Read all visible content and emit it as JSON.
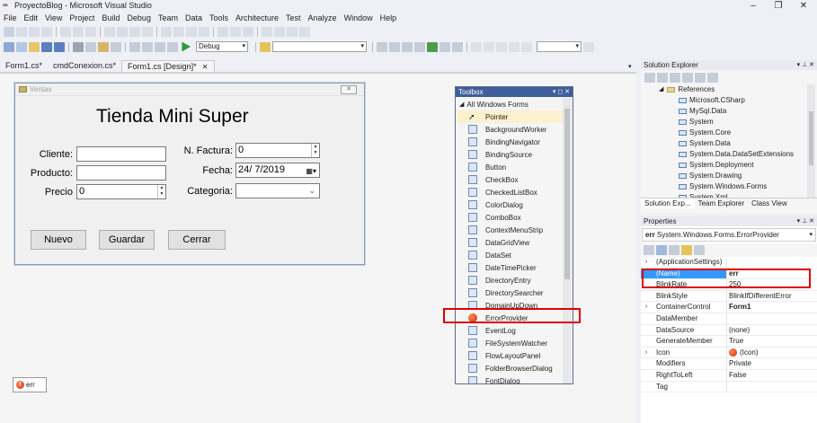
{
  "window": {
    "title": "ProyectoBlog - Microsoft Visual Studio",
    "min": "–",
    "restore": "❐",
    "close": "✕"
  },
  "menu": [
    "File",
    "Edit",
    "View",
    "Project",
    "Build",
    "Debug",
    "Team",
    "Data",
    "Tools",
    "Architecture",
    "Test",
    "Analyze",
    "Window",
    "Help"
  ],
  "toolbar": {
    "config": "Debug"
  },
  "tabs": [
    {
      "label": "Form1.cs*"
    },
    {
      "label": "cmdConexion.cs*"
    },
    {
      "label": "Form1.cs [Design]*",
      "active": true
    }
  ],
  "form": {
    "title": "Ventas",
    "heading": "Tienda Mini Super",
    "cliente_label": "Cliente:",
    "producto_label": "Producto:",
    "precio_label": "Precio",
    "precio_value": "0",
    "factura_label": "N. Factura:",
    "factura_value": "0",
    "fecha_label": "Fecha:",
    "fecha_value": "24/  7/2019",
    "categoria_label": "Categoria:",
    "buttons": {
      "nuevo": "Nuevo",
      "guardar": "Guardar",
      "cerrar": "Cerrar"
    }
  },
  "tray": {
    "component": "err"
  },
  "toolbox": {
    "title": "Toolbox",
    "group": "All Windows Forms",
    "items": [
      "Pointer",
      "BackgroundWorker",
      "BindingNavigator",
      "BindingSource",
      "Button",
      "CheckBox",
      "CheckedListBox",
      "ColorDialog",
      "ComboBox",
      "ContextMenuStrip",
      "DataGridView",
      "DataSet",
      "DateTimePicker",
      "DirectoryEntry",
      "DirectorySearcher",
      "DomainUpDown",
      "ErrorProvider",
      "EventLog",
      "FileSystemWatcher",
      "FlowLayoutPanel",
      "FolderBrowserDialog",
      "FontDialog"
    ]
  },
  "solution_explorer": {
    "title": "Solution Explorer",
    "references_label": "References",
    "refs": [
      "Microsoft.CSharp",
      "MySql.Data",
      "System",
      "System.Core",
      "System.Data",
      "System.Data.DataSetExtensions",
      "System.Deployment",
      "System.Drawing",
      "System.Windows.Forms",
      "System.Xml"
    ],
    "tabs": [
      "Solution Exp...",
      "Team Explorer",
      "Class View"
    ]
  },
  "properties": {
    "title": "Properties",
    "object_name": "err",
    "object_type": "System.Windows.Forms.ErrorProvider",
    "rows": [
      {
        "name": "(ApplicationSettings)",
        "value": "",
        "expand": true
      },
      {
        "name": "(Name)",
        "value": "err",
        "selected": true
      },
      {
        "name": "BlinkRate",
        "value": "250"
      },
      {
        "name": "BlinkStyle",
        "value": "BlinkIfDifferentError"
      },
      {
        "name": "ContainerControl",
        "value": "Form1",
        "expand": true
      },
      {
        "name": "DataMember",
        "value": ""
      },
      {
        "name": "DataSource",
        "value": "(none)"
      },
      {
        "name": "GenerateMember",
        "value": "True"
      },
      {
        "name": "Icon",
        "value": "(Icon)",
        "expand": true
      },
      {
        "name": "Modifiers",
        "value": "Private"
      },
      {
        "name": "RightToLeft",
        "value": "False"
      },
      {
        "name": "Tag",
        "value": ""
      }
    ]
  },
  "colors": {
    "accent": "#3e5f9a",
    "highlight": "#e00000",
    "selection": "#3399ff"
  }
}
